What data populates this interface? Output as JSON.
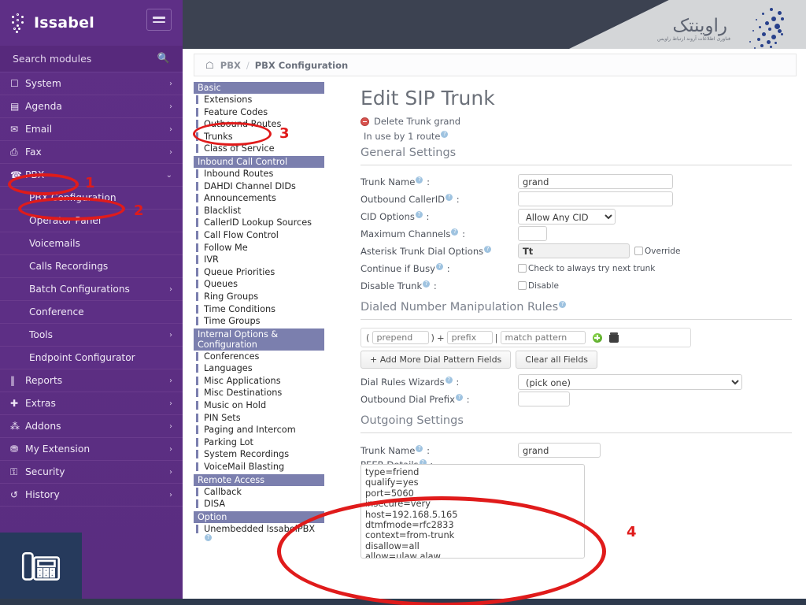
{
  "brand": {
    "name": "Issabel",
    "logo_icon": "issabel-dots-logo",
    "menu_icon": "hamburger-menu-icon"
  },
  "sidebar": {
    "search": {
      "placeholder": "Search modules",
      "label": "Search modules",
      "icon": "search-icon"
    },
    "items": [
      {
        "label": "System",
        "icon": "monitor-icon",
        "chevron": "›",
        "sub": false
      },
      {
        "label": "Agenda",
        "icon": "book-icon",
        "chevron": "›",
        "sub": false
      },
      {
        "label": "Email",
        "icon": "envelope-icon",
        "chevron": "›",
        "sub": false
      },
      {
        "label": "Fax",
        "icon": "printer-icon",
        "chevron": "›",
        "sub": false
      },
      {
        "label": "PBX",
        "icon": "phone-icon",
        "chevron": "⌄",
        "sub": false
      },
      {
        "label": "PBX Configuration",
        "icon": "",
        "chevron": "",
        "sub": true
      },
      {
        "label": "Operator Panel",
        "icon": "",
        "chevron": "",
        "sub": true
      },
      {
        "label": "Voicemails",
        "icon": "",
        "chevron": "",
        "sub": true
      },
      {
        "label": "Calls Recordings",
        "icon": "",
        "chevron": "",
        "sub": true
      },
      {
        "label": "Batch Configurations",
        "icon": "",
        "chevron": "›",
        "sub": true
      },
      {
        "label": "Conference",
        "icon": "",
        "chevron": "",
        "sub": true
      },
      {
        "label": "Tools",
        "icon": "",
        "chevron": "›",
        "sub": true
      },
      {
        "label": "Endpoint Configurator",
        "icon": "",
        "chevron": "",
        "sub": true
      },
      {
        "label": "Reports",
        "icon": "chart-bar-icon",
        "chevron": "›",
        "sub": false
      },
      {
        "label": "Extras",
        "icon": "plus-icon",
        "chevron": "›",
        "sub": false
      },
      {
        "label": "Addons",
        "icon": "puzzle-icon",
        "chevron": "›",
        "sub": false
      },
      {
        "label": "My Extension",
        "icon": "briefcase-icon",
        "chevron": "›",
        "sub": false
      },
      {
        "label": "Security",
        "icon": "lock-icon",
        "chevron": "›",
        "sub": false
      },
      {
        "label": "History",
        "icon": "history-icon",
        "chevron": "›",
        "sub": false
      }
    ]
  },
  "header": {
    "logo_text_fa": "راوینتک",
    "logo_sub_fa": "فناوری اطلاعات آروند ارتباط راویس",
    "dot_logo_icon": "dot-cluster-logo"
  },
  "breadcrumb": {
    "home_icon": "home-icon",
    "items": [
      "PBX",
      "PBX Configuration"
    ],
    "separator": "/"
  },
  "pbx_menu": {
    "groups": [
      {
        "title": "Basic",
        "items": [
          "Extensions",
          "Feature Codes",
          "Outbound Routes",
          "Trunks",
          "Class of Service"
        ]
      },
      {
        "title": "Inbound Call Control",
        "items": [
          "Inbound Routes",
          "DAHDI Channel DIDs",
          "Announcements",
          "Blacklist",
          "CallerID Lookup Sources",
          "Call Flow Control",
          "Follow Me",
          "IVR",
          "Queue Priorities",
          "Queues",
          "Ring Groups",
          "Time Conditions",
          "Time Groups"
        ]
      },
      {
        "title": "Internal Options & Configuration",
        "items": [
          "Conferences",
          "Languages",
          "Misc Applications",
          "Misc Destinations",
          "Music on Hold",
          "PIN Sets",
          "Paging and Intercom",
          "Parking Lot",
          "System Recordings",
          "VoiceMail Blasting"
        ]
      },
      {
        "title": "Remote Access",
        "items": [
          "Callback",
          "DISA"
        ]
      },
      {
        "title": "Option",
        "items": [
          "Unembedded IssabelPBX"
        ]
      }
    ]
  },
  "main": {
    "page_title": "Edit SIP Trunk",
    "delete_link": "Delete Trunk grand",
    "in_use": "In use by 1 route",
    "general_settings_title": "General Settings",
    "dialed_rules_title": "Dialed Number Manipulation Rules",
    "outgoing_settings_title": "Outgoing Settings",
    "general": {
      "trunk_name_label": "Trunk Name",
      "trunk_name_value": "grand",
      "outbound_callerid_label": "Outbound CallerID",
      "outbound_callerid_value": "",
      "cid_options_label": "CID Options",
      "cid_options_value": "Allow Any CID",
      "max_channels_label": "Maximum Channels",
      "max_channels_value": "",
      "dial_options_label": "Asterisk Trunk Dial Options",
      "dial_options_value": "Tt",
      "override_label": "Override",
      "continue_busy_label": "Continue if Busy",
      "continue_busy_checkbox_label": "Check to always try next trunk",
      "disable_trunk_label": "Disable Trunk",
      "disable_checkbox_label": "Disable"
    },
    "dial_pattern": {
      "open_paren": "(",
      "prepend_placeholder": "prepend",
      "close_paren": ")",
      "plus": "+",
      "prefix_placeholder": "prefix",
      "pipe": "|",
      "match_placeholder": "match pattern",
      "add_icon": "add-circle-icon",
      "delete_icon": "trash-icon",
      "add_more_button": "+ Add More Dial Pattern Fields",
      "clear_button": "Clear all Fields",
      "wizard_label": "Dial Rules Wizards",
      "wizard_value": "(pick one)",
      "outbound_prefix_label": "Outbound Dial Prefix",
      "outbound_prefix_value": ""
    },
    "outgoing": {
      "trunk_name_label": "Trunk Name",
      "trunk_name_value": "grand",
      "peer_details_label": "PEER Details",
      "peer_details_value": "type=friend\nqualify=yes\nport=5060\ninsecure=very\nhost=192.168.5.165\ndtmfmode=rfc2833\ncontext=from-trunk\ndisallow=all\nallow=ulaw,alaw"
    }
  },
  "annotations": {
    "color": "#e01b1b",
    "markers": [
      {
        "number": "1",
        "target": "sidebar-item-pbx"
      },
      {
        "number": "2",
        "target": "sidebar-item-pbx-configuration"
      },
      {
        "number": "3",
        "target": "pbx-menu-item-trunks"
      },
      {
        "number": "4",
        "target": "peer-details-textarea"
      }
    ]
  },
  "footer": {
    "phone_icon": "desk-phone-icon"
  }
}
